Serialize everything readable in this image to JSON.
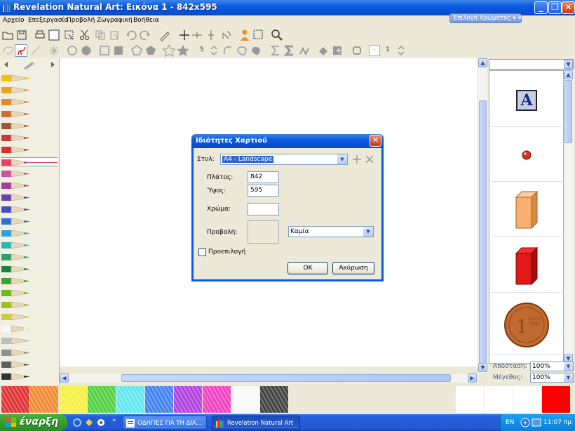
{
  "window": {
    "title": "Revelation Natural Art: Εικόνα 1 - 842x595",
    "min_label": "_",
    "max_label": "❐",
    "close_label": "✕"
  },
  "menu": {
    "items": [
      "Αρχείο",
      "Επεξεργασία",
      "Προβολή",
      "Ζωγραφική",
      "Βοήθεια"
    ],
    "color_pick_tab": "Επιλογή Χρώματος ▾ ✕"
  },
  "toolbar2": {
    "size_value": "5",
    "opacity_value": "1"
  },
  "dialog": {
    "title": "Ιδιότητες Χαρτιού",
    "style_label": "Στυλ:",
    "style_value": "A4 - Landscape",
    "width_label": "Πλάτος:",
    "width_value": "842",
    "height_label": "Ύψος:",
    "height_value": "595",
    "color_label": "Χρώμα:",
    "view_label": "Προβολή:",
    "view_value": "Καμία",
    "default_label": "Προεπιλογή",
    "ok_label": "OK",
    "cancel_label": "Ακύρωση"
  },
  "right_panel": {
    "items": [
      "letter-A-block",
      "red-dot",
      "orange-box",
      "red-box",
      "euro-cent-coin"
    ],
    "letter": "A",
    "distance_label": "Απόσταση:",
    "distance_value": "100%",
    "size_label": "Μέγεθος:",
    "size_value": "100%"
  },
  "colors": {
    "pencils": [
      "#f5c000",
      "#f0a020",
      "#e08a30",
      "#c87038",
      "#a05a30",
      "#c04040",
      "#d83030",
      "#e84060",
      "#d050a0",
      "#a040a0",
      "#7040b0",
      "#4050c0",
      "#3070d0",
      "#30a0d8",
      "#30b8b0",
      "#30a070",
      "#208040",
      "#40a030",
      "#70b820",
      "#a0c020",
      "#c8d040",
      "#f8f8f8",
      "#c0c0c0",
      "#909090",
      "#606060",
      "#303030"
    ],
    "swatches": [
      "#e03030",
      "#f08a30",
      "#f8f040",
      "#50d040",
      "#60e8f0",
      "#4080f0",
      "#b040e0",
      "#f040c0",
      "#f8f8f8",
      "#404040"
    ],
    "right_swatches": [
      "#ffffff",
      "#ffffff",
      "#ffffff",
      "#ff0000"
    ]
  },
  "taskbar": {
    "start_label": "έναρξη",
    "task1": "ΟΔΗΓΙΕΣ ΓΙΑ ΤΗ ΔΙΑ...",
    "task2": "Revelation Natural Art",
    "lang": "EN",
    "time": "11:07 πμ"
  }
}
